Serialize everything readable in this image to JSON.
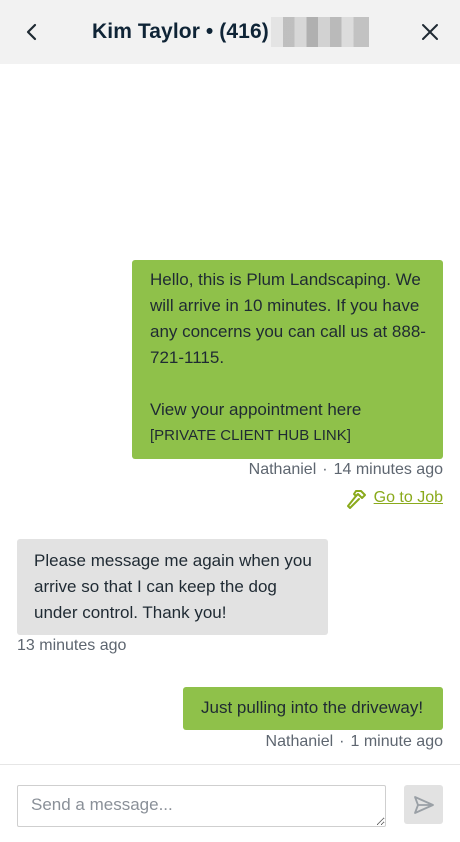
{
  "header": {
    "title": "Kim Taylor • (416)",
    "back_icon": "chevron-left-icon",
    "close_icon": "close-icon"
  },
  "messages": [
    {
      "direction": "outgoing",
      "lines": [
        "Hello, this is Plum Landscaping. We",
        "will arrive in 10 minutes. If you have",
        "any concerns you can call us at 888-",
        "721-1115.",
        "",
        "View your appointment here"
      ],
      "link_text": "[PRIVATE CLIENT HUB LINK]",
      "sender": "Nathaniel",
      "time": "14 minutes ago",
      "action_label": "Go to Job",
      "action_icon": "hammer-icon"
    },
    {
      "direction": "incoming",
      "lines": [
        "Please message me again when you",
        "arrive so that I can keep the dog",
        "under control. Thank you!"
      ],
      "time": "13 minutes ago"
    },
    {
      "direction": "outgoing",
      "lines": [
        "Just pulling into the driveway!"
      ],
      "sender": "Nathaniel",
      "time": "1 minute ago"
    }
  ],
  "composer": {
    "placeholder": "Send a message...",
    "value": "",
    "send_icon": "send-icon"
  },
  "colors": {
    "outgoing_bubble": "#8fc14a",
    "incoming_bubble": "#e2e2e2",
    "header_bg": "#f2f2f2",
    "link": "#8aaa1c"
  }
}
